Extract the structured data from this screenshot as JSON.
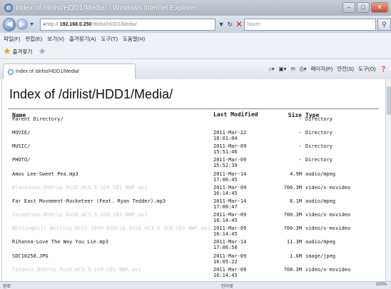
{
  "window": {
    "title": "Index of /dirlist/HDD1/Media/ - Windows Internet Explorer"
  },
  "address": {
    "scheme": "http://",
    "host": "192.168.0.250",
    "path": "/dirlist/HDD1/Media/",
    "search_placeholder": "Naver"
  },
  "menu": [
    "파일(F)",
    "편집(E)",
    "보기(V)",
    "즐겨찾기(A)",
    "도구(T)",
    "도움말(H)"
  ],
  "favorites": {
    "label": "즐겨찾기"
  },
  "tab": {
    "label": "Index of /dirlist/HDD1/Media/"
  },
  "commandbar": {
    "page": "페이지(P)",
    "safety": "안전(S)",
    "tools": "도구(O)"
  },
  "page": {
    "heading": "Index of /dirlist/HDD1/Media/",
    "columns": {
      "name": "Name",
      "modified": "Last Modified",
      "size": "Size",
      "type": "Type"
    },
    "rows": [
      {
        "name": "Parent Directory/",
        "date": "",
        "time": "",
        "size": "-",
        "type": "Directory",
        "blurred": false
      },
      {
        "name": "MOVIE/",
        "date": "2011-Mar-22",
        "time": "18:01:04",
        "size": "-",
        "type": "Directory",
        "blurred": false
      },
      {
        "name": "MUSIC/",
        "date": "2011-Mar-09",
        "time": "15:51:46",
        "size": "-",
        "type": "Directory",
        "blurred": false
      },
      {
        "name": "PHOTO/",
        "date": "2011-Mar-09",
        "time": "15:52:39",
        "size": "-",
        "type": "Directory",
        "blurred": false
      },
      {
        "name": "Amos Lee-Sweet Pea.mp3",
        "date": "2011-Mar-14",
        "time": "17:06:45",
        "size": "4.9M",
        "type": "audio/mpeg",
        "blurred": false
      },
      {
        "name": "Blackswan.DVDrip.XviD.AC3.5.1CH.CD1-NWF.avi",
        "date": "2011-Mar-09",
        "time": "16:14:45",
        "size": "700.3M",
        "type": "video/x-msvideo",
        "blurred": true
      },
      {
        "name": "Far East Movement-Rocketeer (Feat. Ryan Tedder).mp3",
        "date": "2011-Mar-14",
        "time": "17:06:47",
        "size": "8.1M",
        "type": "audio/mpeg",
        "blurred": false
      },
      {
        "name": "Inception.DVDrip.XviD.AC3.5.1CH.CD1-NWF.avi",
        "date": "2011-Mar-09",
        "time": "16:14:45",
        "size": "700.3M",
        "type": "video/x-msvideo",
        "blurred": true
      },
      {
        "name": "NottingHill.Notting.Hill.1999.DVDrip.XviD.AC3.5.1CH.CD1-NWF.avi",
        "date": "2011-Mar-09",
        "time": "16:14:45",
        "size": "700.3M",
        "type": "video/x-msvideo",
        "blurred": true
      },
      {
        "name": "Rihanna-Love The Way You Lie.mp3",
        "date": "2011-Mar-14",
        "time": "17:06:50",
        "size": "11.3M",
        "type": "audio/mpeg",
        "blurred": false
      },
      {
        "name": "SDC10258.JPG",
        "date": "2011-Mar-09",
        "time": "16:05:22",
        "size": "1.6M",
        "type": "image/jpeg",
        "blurred": false
      },
      {
        "name": "Titanic.DVDrip.XviD.AC3.5.1CH.CD1-NWF.avi",
        "date": "2011-Mar-09",
        "time": "16:14:45",
        "size": "700.3M",
        "type": "video/x-msvideo",
        "blurred": true
      }
    ]
  },
  "status": {
    "left": "완료",
    "zone": "인터넷",
    "zoom": "100%"
  }
}
